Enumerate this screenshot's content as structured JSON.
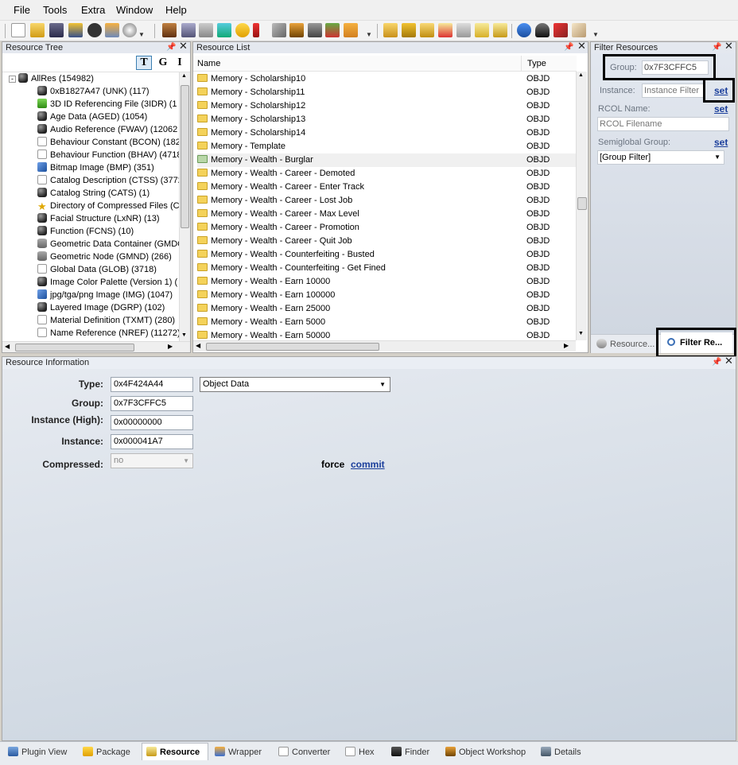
{
  "menu": [
    "File",
    "Tools",
    "Extra",
    "Window",
    "Help"
  ],
  "resource_tree": {
    "title": "Resource Tree",
    "view_buttons": [
      "T",
      "G",
      "I"
    ],
    "root": "AllRes (154982)",
    "items": [
      {
        "label": "0xB1827A47 (UNK) (117)",
        "icon": "cube-icon"
      },
      {
        "label": "3D ID Referencing File (3IDR) (1",
        "icon": "green-arrow-icon"
      },
      {
        "label": "Age Data (AGED) (1054)",
        "icon": "cube-icon"
      },
      {
        "label": "Audio Reference (FWAV) (12062",
        "icon": "cube-icon"
      },
      {
        "label": "Behaviour Constant (BCON) (182",
        "icon": "document-icon"
      },
      {
        "label": "Behaviour Function (BHAV) (4718",
        "icon": "document-icon"
      },
      {
        "label": "Bitmap Image (BMP) (351)",
        "icon": "image-icon"
      },
      {
        "label": "Catalog Description (CTSS) (3772",
        "icon": "document-icon"
      },
      {
        "label": "Catalog String (CATS) (1)",
        "icon": "cube-icon"
      },
      {
        "label": "Directory of Compressed Files (C",
        "icon": "star-icon"
      },
      {
        "label": "Facial Structure (LxNR) (13)",
        "icon": "cube-icon"
      },
      {
        "label": "Function (FCNS) (10)",
        "icon": "cube-icon"
      },
      {
        "label": "Geometric Data Container (GMDC",
        "icon": "database-icon"
      },
      {
        "label": "Geometric Node (GMND) (266)",
        "icon": "database-icon"
      },
      {
        "label": "Global Data (GLOB) (3718)",
        "icon": "document-icon"
      },
      {
        "label": "Image Color Palette (Version 1) (",
        "icon": "cube-icon"
      },
      {
        "label": "jpg/tga/png Image (IMG) (1047)",
        "icon": "image-icon"
      },
      {
        "label": "Layered Image (DGRP) (102)",
        "icon": "cube-icon"
      },
      {
        "label": "Material Definition (TXMT) (280)",
        "icon": "document-icon"
      },
      {
        "label": "Name Reference (NREF) (11272)",
        "icon": "document-icon"
      }
    ]
  },
  "resource_list": {
    "title": "Resource List",
    "columns": [
      "Name",
      "Type"
    ],
    "selected_index": 6,
    "rows": [
      {
        "name": "Memory - Scholarship10",
        "type": "OBJD"
      },
      {
        "name": "Memory - Scholarship11",
        "type": "OBJD"
      },
      {
        "name": "Memory - Scholarship12",
        "type": "OBJD"
      },
      {
        "name": "Memory - Scholarship13",
        "type": "OBJD"
      },
      {
        "name": "Memory - Scholarship14",
        "type": "OBJD"
      },
      {
        "name": "Memory - Template",
        "type": "OBJD"
      },
      {
        "name": "Memory - Wealth - Burglar",
        "type": "OBJD"
      },
      {
        "name": "Memory - Wealth - Career - Demoted",
        "type": "OBJD"
      },
      {
        "name": "Memory - Wealth - Career - Enter Track",
        "type": "OBJD"
      },
      {
        "name": "Memory - Wealth - Career - Lost Job",
        "type": "OBJD"
      },
      {
        "name": "Memory - Wealth - Career - Max Level",
        "type": "OBJD"
      },
      {
        "name": "Memory - Wealth - Career - Promotion",
        "type": "OBJD"
      },
      {
        "name": "Memory - Wealth - Career - Quit Job",
        "type": "OBJD"
      },
      {
        "name": "Memory - Wealth - Counterfeiting - Busted",
        "type": "OBJD"
      },
      {
        "name": "Memory - Wealth - Counterfeiting - Get Fined",
        "type": "OBJD"
      },
      {
        "name": "Memory - Wealth - Earn 10000",
        "type": "OBJD"
      },
      {
        "name": "Memory - Wealth - Earn 100000",
        "type": "OBJD"
      },
      {
        "name": "Memory - Wealth - Earn 25000",
        "type": "OBJD"
      },
      {
        "name": "Memory - Wealth - Earn 5000",
        "type": "OBJD"
      },
      {
        "name": "Memory - Wealth - Earn 50000",
        "type": "OBJD"
      }
    ]
  },
  "filter_resources": {
    "title": "Filter Resources",
    "group_label": "Group:",
    "group_value": "0x7F3CFFC5",
    "instance_label": "Instance:",
    "instance_placeholder": "Instance Filter",
    "rcol_label": "RCOL Name:",
    "rcol_placeholder": "RCOL Filename",
    "semiglobal_label": "Semiglobal Group:",
    "semiglobal_value": "[Group Filter]",
    "set_label": "set",
    "tabs": [
      "Resource...",
      "Filter Re..."
    ]
  },
  "resource_info": {
    "title": "Resource Information",
    "type_label": "Type:",
    "type_value": "0x4F424A44",
    "type_name": "Object Data",
    "group_label": "Group:",
    "group_value": "0x7F3CFFC5",
    "instance_high_label": "Instance (High):",
    "instance_high_value": "0x00000000",
    "instance_label": "Instance:",
    "instance_value": "0x000041A7",
    "compressed_label": "Compressed:",
    "compressed_value": "no",
    "force_label": "force",
    "commit_label": "commit"
  },
  "bottom_tabs": [
    "Plugin View",
    "Package",
    "Resource",
    "Wrapper",
    "Converter",
    "Hex",
    "Finder",
    "Object Workshop",
    "Details"
  ],
  "active_bottom_tab": "Resource"
}
